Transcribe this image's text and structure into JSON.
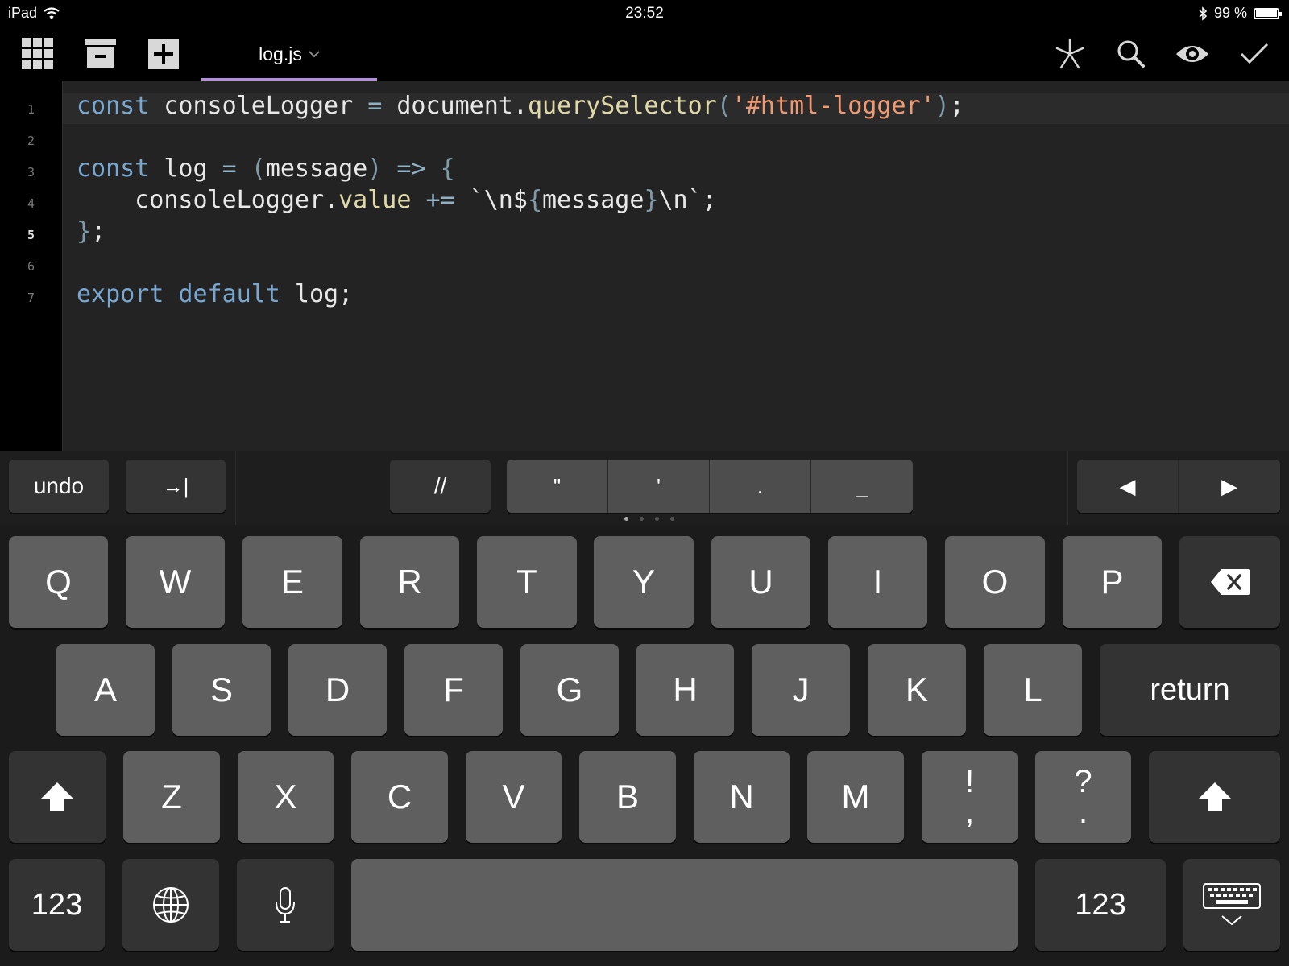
{
  "status": {
    "device": "iPad",
    "time": "23:52",
    "battery_text": "99 %",
    "battery_level": 0.99
  },
  "toolbar": {
    "tab": {
      "label": "log.js"
    },
    "icons": [
      "grid-icon",
      "archive-icon",
      "plus-icon",
      "asterisk-icon",
      "search-icon",
      "eye-icon",
      "checkmark-icon"
    ],
    "tab_underline_color": "#b48ce0"
  },
  "editor": {
    "line_numbers": [
      "1",
      "2",
      "3",
      "4",
      "5",
      "6",
      "7"
    ],
    "current_line": 5,
    "line1": {
      "kw": "const",
      "var": " consoleLogger ",
      "op": "=",
      "obj": " document",
      "dot": ".",
      "fn": "querySelector",
      "lp": "(",
      "str": "'#html-logger'",
      "rp": ")",
      "end": ";"
    },
    "line3": {
      "kw": "const",
      "var": " log ",
      "op": "=",
      "lp": " (",
      "param": "message",
      "rp": ")",
      "arrow": " => ",
      "brace": "{"
    },
    "line4": {
      "indent": "    ",
      "obj": "consoleLogger",
      "dot": ".",
      "prop": "value",
      "op": " += ",
      "t1": "`\\n$",
      "lb": "{",
      "expr": "message",
      "rb": "}",
      "t2": "\\n`",
      "end": ";"
    },
    "line5": {
      "brace": "}",
      "end": ";"
    },
    "line7": {
      "kw1": "export",
      "kw2": " default",
      "rest": " log;"
    }
  },
  "shortcuts": {
    "undo": "undo",
    "tab": "→|",
    "comment": "//",
    "chars": [
      "\"",
      "'",
      ".",
      "_"
    ],
    "left_arrow": "◀",
    "right_arrow": "▶"
  },
  "keyboard": {
    "row1": [
      "Q",
      "W",
      "E",
      "R",
      "T",
      "Y",
      "U",
      "I",
      "O",
      "P"
    ],
    "row2": [
      "A",
      "S",
      "D",
      "F",
      "G",
      "H",
      "J",
      "K",
      "L"
    ],
    "row3": [
      "Z",
      "X",
      "C",
      "V",
      "B",
      "N",
      "M"
    ],
    "punct1": {
      "top": "!",
      "bottom": ","
    },
    "punct2": {
      "top": "?",
      "bottom": "."
    },
    "return": "return",
    "numbers_left": "123",
    "numbers_right": "123"
  }
}
